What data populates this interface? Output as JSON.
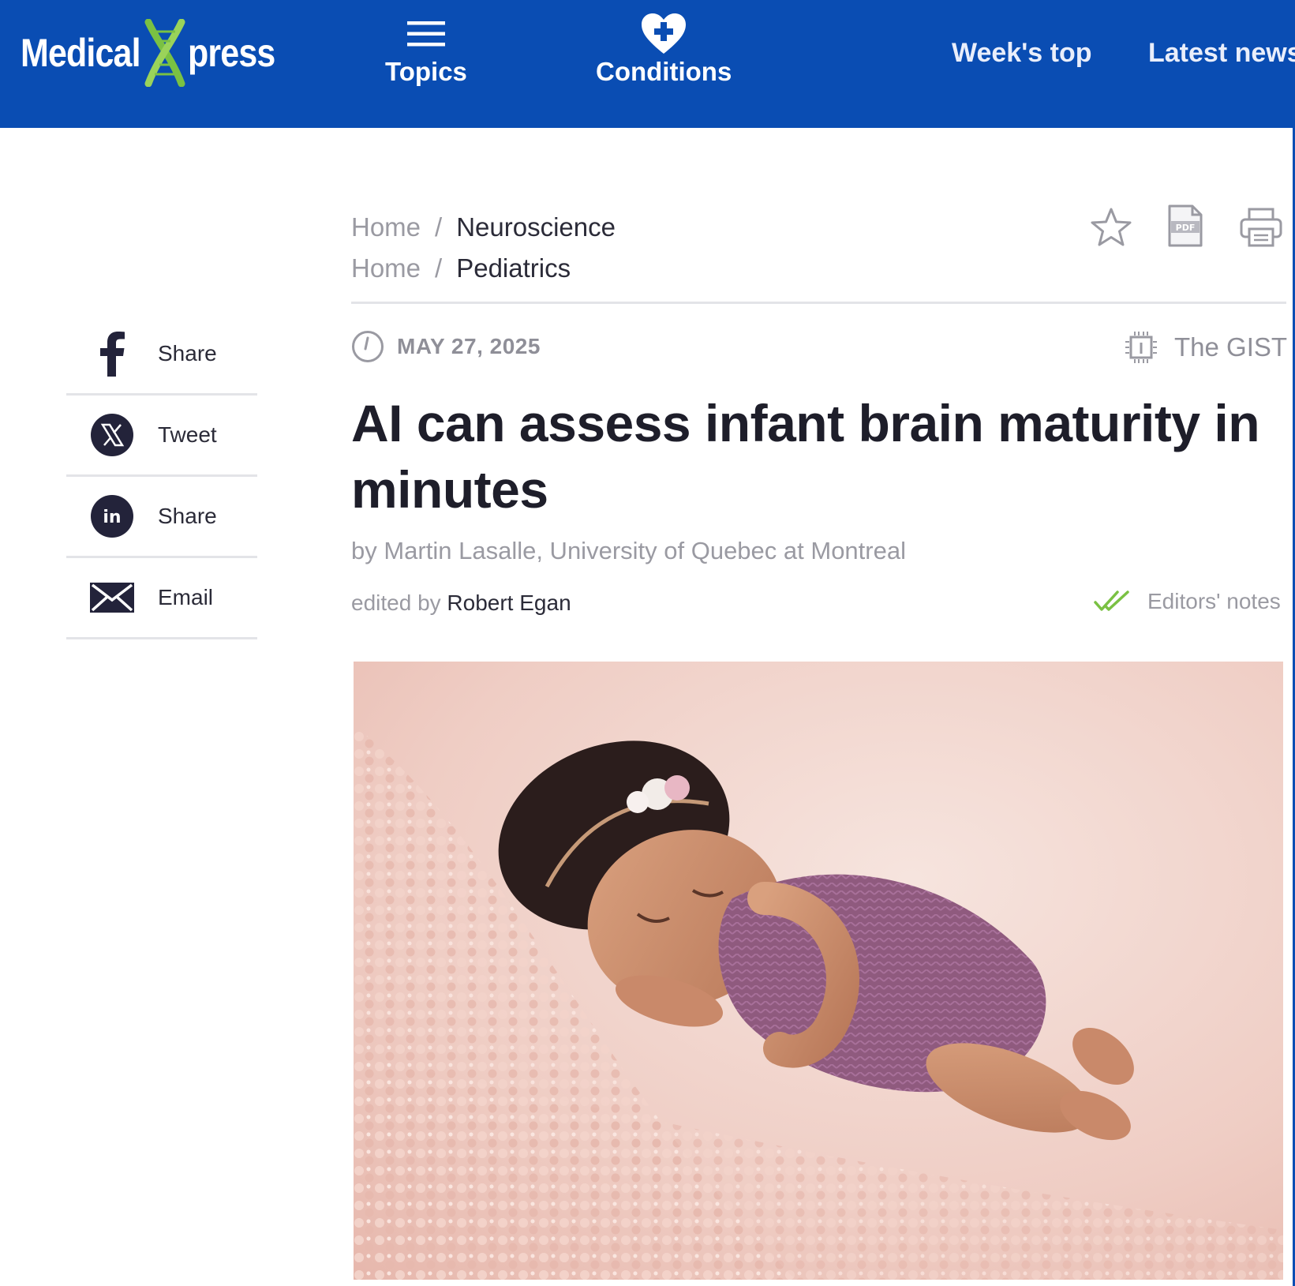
{
  "brand": {
    "word1": "Medical",
    "word2": "press",
    "color_bar": "#0a4db3",
    "accent": "#7ac143"
  },
  "nav": {
    "topics_label": "Topics",
    "conditions_label": "Conditions",
    "weeks_top": "Week's top",
    "latest_news": "Latest news"
  },
  "breadcrumbs": [
    {
      "home": "Home",
      "sep": "/",
      "category": "Neuroscience"
    },
    {
      "home": "Home",
      "sep": "/",
      "category": "Pediatrics"
    }
  ],
  "tools": {
    "bookmark_icon": "star-icon",
    "pdf_icon": "pdf-icon",
    "pdf_text": "PDF",
    "print_icon": "print-icon"
  },
  "share": [
    {
      "icon": "facebook-icon",
      "label": "Share"
    },
    {
      "icon": "x-icon",
      "label": "Tweet"
    },
    {
      "icon": "linkedin-icon",
      "label": "Share"
    },
    {
      "icon": "email-icon",
      "label": "Email"
    }
  ],
  "article": {
    "date": "MAY 27, 2025",
    "gist": "The GIST",
    "title": "AI can assess infant brain maturity in minutes",
    "byline": "by Martin Lasalle, University of Quebec at Montreal",
    "edited_prefix": "edited by",
    "editor": "Robert Egan",
    "editors_notes": "Editors' notes"
  }
}
